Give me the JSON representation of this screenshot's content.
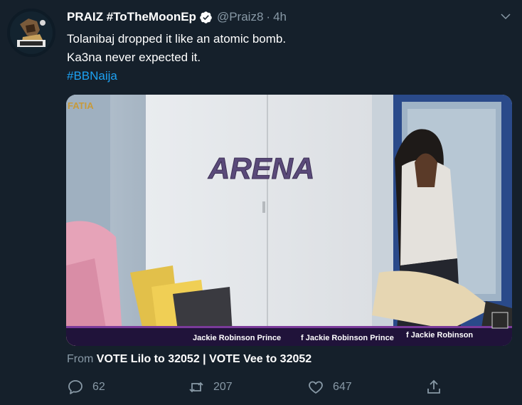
{
  "tweet": {
    "display_name": "PRAIZ #ToTheMoonEp",
    "handle": "@Praiz8",
    "separator": "·",
    "time": "4h",
    "text_lines": [
      "Tolanibaj dropped it like an atomic bomb.",
      "Ka3na never expected it."
    ],
    "hashtag": "#BBNaija",
    "media": {
      "sign_text": "ARENA",
      "corner_text": "FATIA",
      "ticker": [
        "Jackie Robinson Prince",
        "f Jackie Robinson Prince",
        "f Jackie Robinson"
      ]
    },
    "source_prefix": "From",
    "source_name": "VOTE Lilo to 32052 | VOTE Vee to 32052",
    "reply_count": "62",
    "retweet_count": "207",
    "like_count": "647"
  },
  "colors": {
    "background": "#15202b",
    "secondary_text": "#8899a6",
    "accent": "#1da1f2"
  }
}
